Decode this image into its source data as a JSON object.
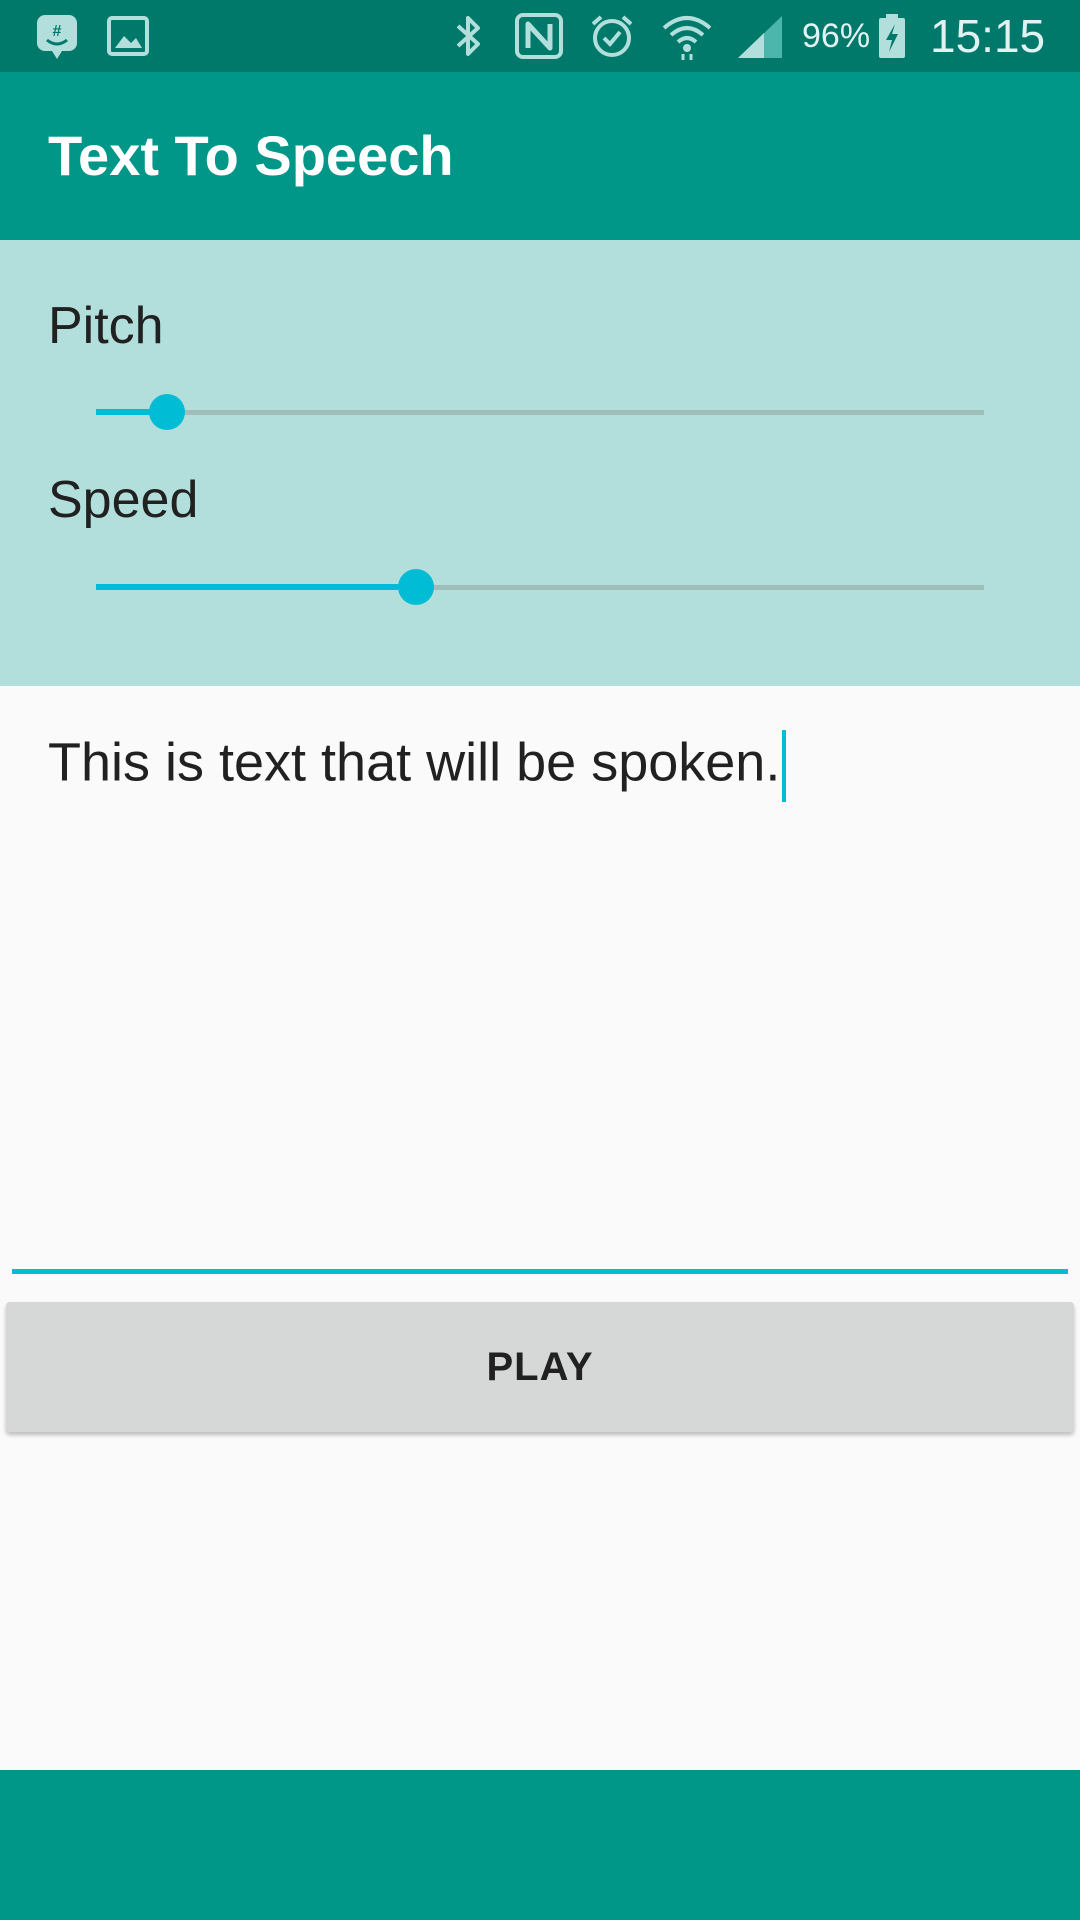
{
  "status_bar": {
    "icons": [
      "hangouts-icon",
      "gallery-icon",
      "bluetooth-icon",
      "nfc-icon",
      "alarm-icon",
      "wifi-icon",
      "signal-icon",
      "battery-icon"
    ],
    "battery_percent": "96%",
    "time": "15:15"
  },
  "app_bar": {
    "title": "Text To Speech"
  },
  "controls": {
    "pitch": {
      "label": "Pitch",
      "value": 0.08
    },
    "speed": {
      "label": "Speed",
      "value": 0.36
    }
  },
  "editor": {
    "value": "This is text that will be spoken."
  },
  "play_button": {
    "label": "PLAY"
  },
  "colors": {
    "primary": "#009688",
    "primary_dark": "#00796b",
    "accent": "#00bcd4",
    "panel": "#b2dfdb"
  }
}
